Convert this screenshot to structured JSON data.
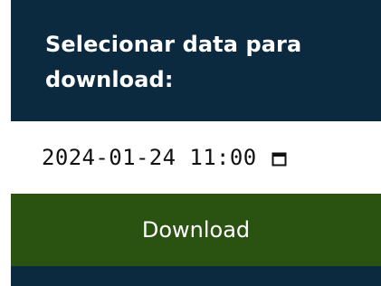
{
  "header": {
    "title": "Selecionar data para download:"
  },
  "datetime_input": {
    "value": "2024-01-24 11:00",
    "icon": "calendar-icon"
  },
  "download_button": {
    "label": "Download"
  },
  "colors": {
    "header_bg": "#0b2a40",
    "button_bg": "#2a5210",
    "input_bg": "#ffffff",
    "text_light": "#ffffff",
    "text_dark": "#111111"
  }
}
